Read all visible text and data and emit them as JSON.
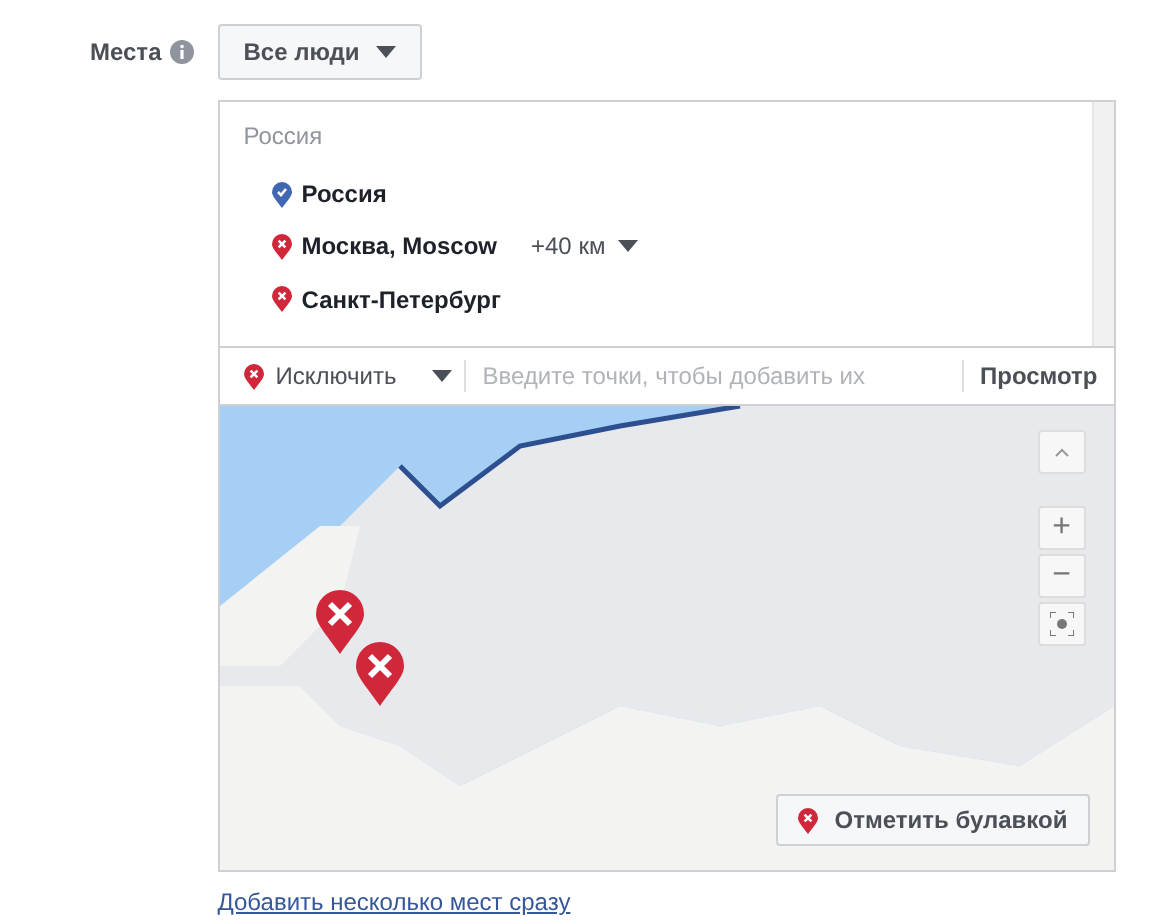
{
  "field_label": "Места",
  "audience_button": "Все люди",
  "locations": {
    "group_label": "Россия",
    "items": [
      {
        "name": "Россия",
        "kind": "include"
      },
      {
        "name": "Москва, Moscow",
        "kind": "exclude",
        "radius": "+40 км"
      },
      {
        "name": "Санкт-Петербург",
        "kind": "exclude"
      }
    ]
  },
  "filter": {
    "mode": "Исключить",
    "placeholder": "Введите точки, чтобы добавить их",
    "browse": "Просмотр"
  },
  "map": {
    "zoom_in": "+",
    "zoom_out": "−",
    "pins": [
      {
        "kind": "exclude"
      },
      {
        "kind": "exclude"
      }
    ],
    "drop_pin": "Отметить булавкой"
  },
  "bulk_link": "Добавить несколько мест сразу"
}
